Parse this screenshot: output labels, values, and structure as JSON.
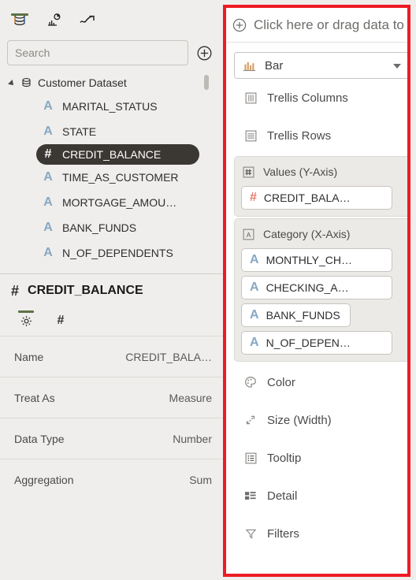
{
  "app": {
    "accent_green": "#5c7247",
    "highlight_red": "#ee1b24",
    "selected_pill_bg": "#3b3834",
    "attribute_color": "#87a8c4",
    "measure_color": "#e8786a"
  },
  "toolbar": {
    "items": [
      {
        "name": "data-icon",
        "label": "Data",
        "selected": true
      },
      {
        "name": "visualizations-icon",
        "label": "Visualizations",
        "selected": false
      },
      {
        "name": "analytics-icon",
        "label": "Analytics",
        "selected": false
      }
    ]
  },
  "search": {
    "placeholder": "Search",
    "value": "",
    "add_button_label": "Add"
  },
  "tree": {
    "root_label": "Customer Dataset",
    "fields": [
      {
        "label": "MARITAL_STATUS",
        "type": "attribute",
        "selected": false
      },
      {
        "label": "STATE",
        "type": "attribute",
        "selected": false
      },
      {
        "label": "CREDIT_BALANCE",
        "type": "measure",
        "selected": true
      },
      {
        "label": "TIME_AS_CUSTOMER",
        "type": "attribute",
        "selected": false
      },
      {
        "label": "MORTGAGE_AMOU…",
        "type": "attribute",
        "selected": false
      },
      {
        "label": "BANK_FUNDS",
        "type": "attribute",
        "selected": false
      },
      {
        "label": "N_OF_DEPENDENTS",
        "type": "attribute",
        "selected": false
      }
    ]
  },
  "properties": {
    "title": "CREDIT_BALANCE",
    "title_icon": "#",
    "tabs": [
      {
        "name": "general-tab",
        "glyph": "gear",
        "selected": true
      },
      {
        "name": "number-format-tab",
        "glyph": "#",
        "selected": false
      }
    ],
    "rows": [
      {
        "label": "Name",
        "value": "CREDIT_BALA…"
      },
      {
        "label": "Treat As",
        "value": "Measure"
      },
      {
        "label": "Data Type",
        "value": "Number"
      },
      {
        "label": "Aggregation",
        "value": "Sum"
      }
    ]
  },
  "viz_panel": {
    "drop_header": "Click here or drag data to",
    "viz_type": "Bar",
    "shelves": [
      {
        "name": "trellis-columns",
        "label": "Trellis Columns",
        "icon": "trellis-columns-icon"
      },
      {
        "name": "trellis-rows",
        "label": "Trellis Rows",
        "icon": "trellis-rows-icon"
      }
    ],
    "values_shelf": {
      "label": "Values (Y-Axis)",
      "icon": "measure-icon",
      "pills": [
        {
          "label": "CREDIT_BALA…",
          "type": "measure"
        }
      ]
    },
    "category_shelf": {
      "label": "Category (X-Axis)",
      "icon": "attribute-icon",
      "pills": [
        {
          "label": "MONTHLY_CH…",
          "type": "attribute",
          "fit": false
        },
        {
          "label": "CHECKING_A…",
          "type": "attribute",
          "fit": false
        },
        {
          "label": "BANK_FUNDS",
          "type": "attribute",
          "fit": true
        },
        {
          "label": "N_OF_DEPEN…",
          "type": "attribute",
          "fit": false
        }
      ]
    },
    "bottom_shelves": [
      {
        "name": "color",
        "label": "Color",
        "icon": "palette-icon"
      },
      {
        "name": "size-width",
        "label": "Size (Width)",
        "icon": "resize-icon"
      },
      {
        "name": "tooltip",
        "label": "Tooltip",
        "icon": "tooltip-icon"
      },
      {
        "name": "detail",
        "label": "Detail",
        "icon": "detail-icon"
      },
      {
        "name": "filters",
        "label": "Filters",
        "icon": "filter-icon"
      }
    ]
  }
}
